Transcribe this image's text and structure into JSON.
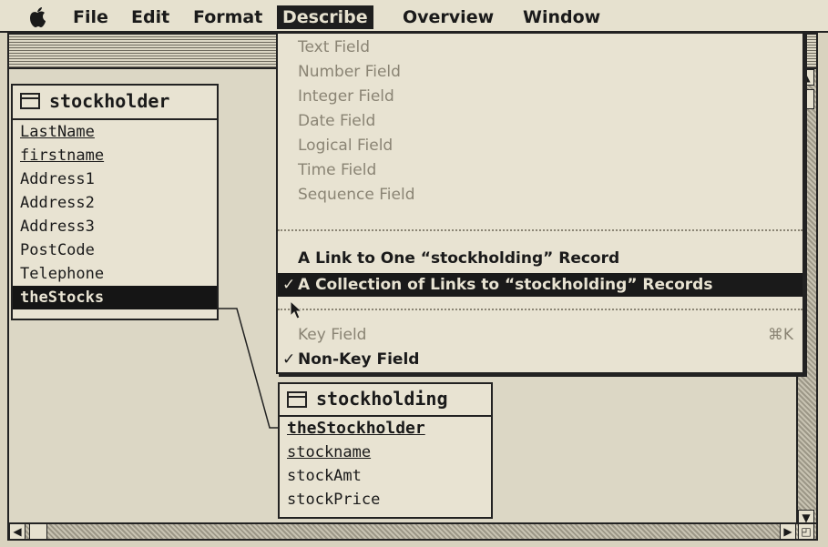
{
  "menubar": {
    "apple_icon": "apple-icon",
    "items": [
      "File",
      "Edit",
      "Format",
      "Describe",
      "Overview",
      "Window"
    ],
    "active": "Describe"
  },
  "entities": {
    "stockholder": {
      "title": "stockholder",
      "fields": [
        "LastName",
        "firstname",
        "Address1",
        "Address2",
        "Address3",
        "PostCode",
        "Telephone",
        "theStocks"
      ],
      "selected": "theStocks"
    },
    "stockholding": {
      "title": "stockholding",
      "fields": [
        "theStockholder",
        "stockname",
        "stockAmt",
        "stockPrice"
      ]
    }
  },
  "describe_menu": {
    "type_items": [
      "Text Field",
      "Number Field",
      "Integer Field",
      "Date Field",
      "Logical Field",
      "Time Field",
      "Sequence Field"
    ],
    "link_one": "A Link to One “stockholding” Record",
    "link_collection": "A Collection of Links to “stockholding” Records",
    "link_collection_check": "✓",
    "key_field": "Key Field",
    "key_field_shortcut": "⌘K",
    "non_key_field": "Non-Key Field",
    "non_key_field_check": "✓"
  },
  "colors": {
    "background": "#d9d3bf",
    "highlight": "#1a1a1a",
    "disabled": "#8a8474"
  }
}
